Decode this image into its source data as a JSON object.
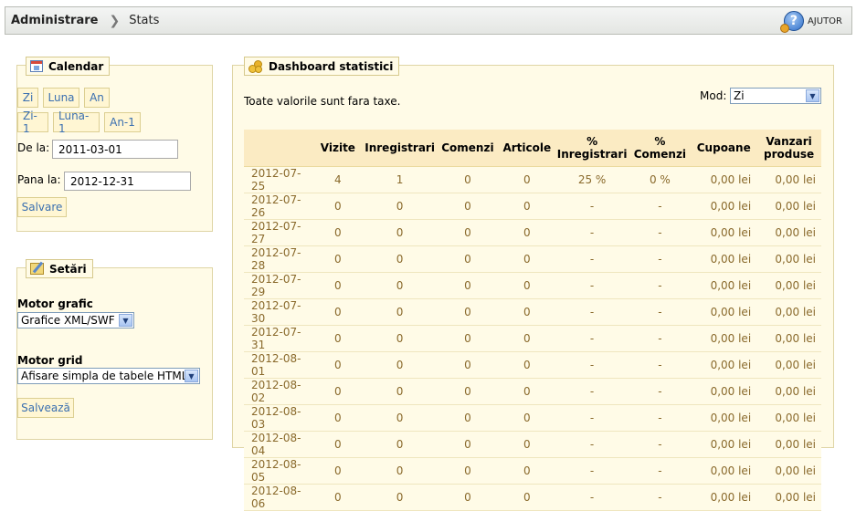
{
  "header": {
    "breadcrumb_main": "Administrare",
    "breadcrumb_separator": "❯",
    "breadcrumb_current": "Stats",
    "help_label": "AJUTOR",
    "help_icon": "help-icon"
  },
  "calendar": {
    "title": "Calendar",
    "icon": "calendar-icon",
    "buttons_row1": [
      "Zi",
      "Luna",
      "An"
    ],
    "buttons_row2": [
      "Zi-1",
      "Luna-1",
      "An-1"
    ],
    "from_label": "De la:",
    "from_value": "2011-03-01",
    "to_label": "Pana la:",
    "to_value": "2012-12-31",
    "save_label": "Salvare"
  },
  "settings": {
    "title": "Setări",
    "icon": "settings-icon",
    "graph_engine_label": "Motor grafic",
    "graph_engine_value": "Grafice XML/SWF",
    "grid_engine_label": "Motor grid",
    "grid_engine_value": "Afisare simpla de tabele HTML",
    "save_label": "Salvează"
  },
  "dashboard": {
    "title": "Dashboard statistici",
    "icon": "coins-icon",
    "note": "Toate valorile sunt fara taxe.",
    "mode_label": "Mod:",
    "mode_value": "Zi",
    "columns": [
      "",
      "Vizite",
      "Inregistrari",
      "Comenzi",
      "Articole",
      "%\nInregistrari",
      "%\nComenzi",
      "Cupoane",
      "Vanzari\nproduse"
    ],
    "rows": [
      [
        "2012-07-25",
        "4",
        "1",
        "0",
        "0",
        "25 %",
        "0 %",
        "0,00 lei",
        "0,00 lei"
      ],
      [
        "2012-07-26",
        "0",
        "0",
        "0",
        "0",
        "-",
        "-",
        "0,00 lei",
        "0,00 lei"
      ],
      [
        "2012-07-27",
        "0",
        "0",
        "0",
        "0",
        "-",
        "-",
        "0,00 lei",
        "0,00 lei"
      ],
      [
        "2012-07-28",
        "0",
        "0",
        "0",
        "0",
        "-",
        "-",
        "0,00 lei",
        "0,00 lei"
      ],
      [
        "2012-07-29",
        "0",
        "0",
        "0",
        "0",
        "-",
        "-",
        "0,00 lei",
        "0,00 lei"
      ],
      [
        "2012-07-30",
        "0",
        "0",
        "0",
        "0",
        "-",
        "-",
        "0,00 lei",
        "0,00 lei"
      ],
      [
        "2012-07-31",
        "0",
        "0",
        "0",
        "0",
        "-",
        "-",
        "0,00 lei",
        "0,00 lei"
      ],
      [
        "2012-08-01",
        "0",
        "0",
        "0",
        "0",
        "-",
        "-",
        "0,00 lei",
        "0,00 lei"
      ],
      [
        "2012-08-02",
        "0",
        "0",
        "0",
        "0",
        "-",
        "-",
        "0,00 lei",
        "0,00 lei"
      ],
      [
        "2012-08-03",
        "0",
        "0",
        "0",
        "0",
        "-",
        "-",
        "0,00 lei",
        "0,00 lei"
      ],
      [
        "2012-08-04",
        "0",
        "0",
        "0",
        "0",
        "-",
        "-",
        "0,00 lei",
        "0,00 lei"
      ],
      [
        "2012-08-05",
        "0",
        "0",
        "0",
        "0",
        "-",
        "-",
        "0,00 lei",
        "0,00 lei"
      ],
      [
        "2012-08-06",
        "0",
        "0",
        "0",
        "0",
        "-",
        "-",
        "0,00 lei",
        "0,00 lei"
      ]
    ]
  }
}
